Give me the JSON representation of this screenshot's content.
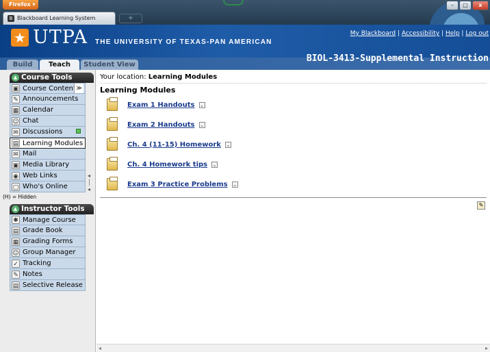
{
  "browser": {
    "menu_button": "Firefox",
    "menu_arrow": "▾",
    "tab_title": "Blackboard Learning System",
    "tab_icon": "blackboard-favicon",
    "new_tab_symbol": "+",
    "controls": {
      "minimize": "–",
      "maximize": "□",
      "close": "x"
    }
  },
  "header": {
    "logo_text": "UTPA",
    "university": "THE UNIVERSITY OF TEXAS-PAN AMERICAN",
    "links": [
      "My Blackboard",
      "Accessibility",
      "Help",
      "Log out"
    ],
    "link_separator": " | ",
    "mode_tabs": [
      "Build",
      "Teach",
      "Student View"
    ],
    "active_mode": "Teach",
    "course_title": "BIOL-3413-Supplemental Instruction"
  },
  "sidebar": {
    "course_tools": {
      "heading": "Course Tools",
      "items": [
        {
          "label": "Course Content",
          "icon": "course-content-icon",
          "glyph": "▣"
        },
        {
          "label": "Announcements",
          "icon": "announcements-icon",
          "glyph": "✎"
        },
        {
          "label": "Calendar",
          "icon": "calendar-icon",
          "glyph": "▦"
        },
        {
          "label": "Chat",
          "icon": "chat-icon",
          "glyph": "☺"
        },
        {
          "label": "Discussions",
          "icon": "discussions-icon",
          "glyph": "✉"
        },
        {
          "label": "Learning Modules",
          "icon": "learning-modules-icon",
          "glyph": "▤"
        },
        {
          "label": "Mail",
          "icon": "mail-icon",
          "glyph": "✉"
        },
        {
          "label": "Media Library",
          "icon": "media-library-icon",
          "glyph": "▣"
        },
        {
          "label": "Web Links",
          "icon": "web-links-icon",
          "glyph": "◉"
        },
        {
          "label": "Who's Online",
          "icon": "whos-online-icon",
          "glyph": "▢"
        }
      ],
      "active_item": "Learning Modules",
      "expand_symbol": "≫",
      "hidden_note": "(H) = Hidden"
    },
    "instructor_tools": {
      "heading": "Instructor Tools",
      "items": [
        {
          "label": "Manage Course",
          "icon": "manage-course-icon",
          "glyph": "✱"
        },
        {
          "label": "Grade Book",
          "icon": "grade-book-icon",
          "glyph": "▤"
        },
        {
          "label": "Grading Forms",
          "icon": "grading-forms-icon",
          "glyph": "▦"
        },
        {
          "label": "Group Manager",
          "icon": "group-manager-icon",
          "glyph": "☺"
        },
        {
          "label": "Tracking",
          "icon": "tracking-icon",
          "glyph": "✓"
        },
        {
          "label": "Notes",
          "icon": "notes-icon",
          "glyph": "✎"
        },
        {
          "label": "Selective Release",
          "icon": "selective-release-icon",
          "glyph": "▤"
        }
      ]
    }
  },
  "main": {
    "location_prefix": "Your location:",
    "location_value": "Learning Modules",
    "title": "Learning Modules",
    "modules": [
      "Exam 1 Handouts",
      "Exam 2 Handouts",
      "Ch. 4 (11-15) Homework",
      "Ch. 4 Homework tips",
      "Exam 3 Practice Problems"
    ]
  }
}
